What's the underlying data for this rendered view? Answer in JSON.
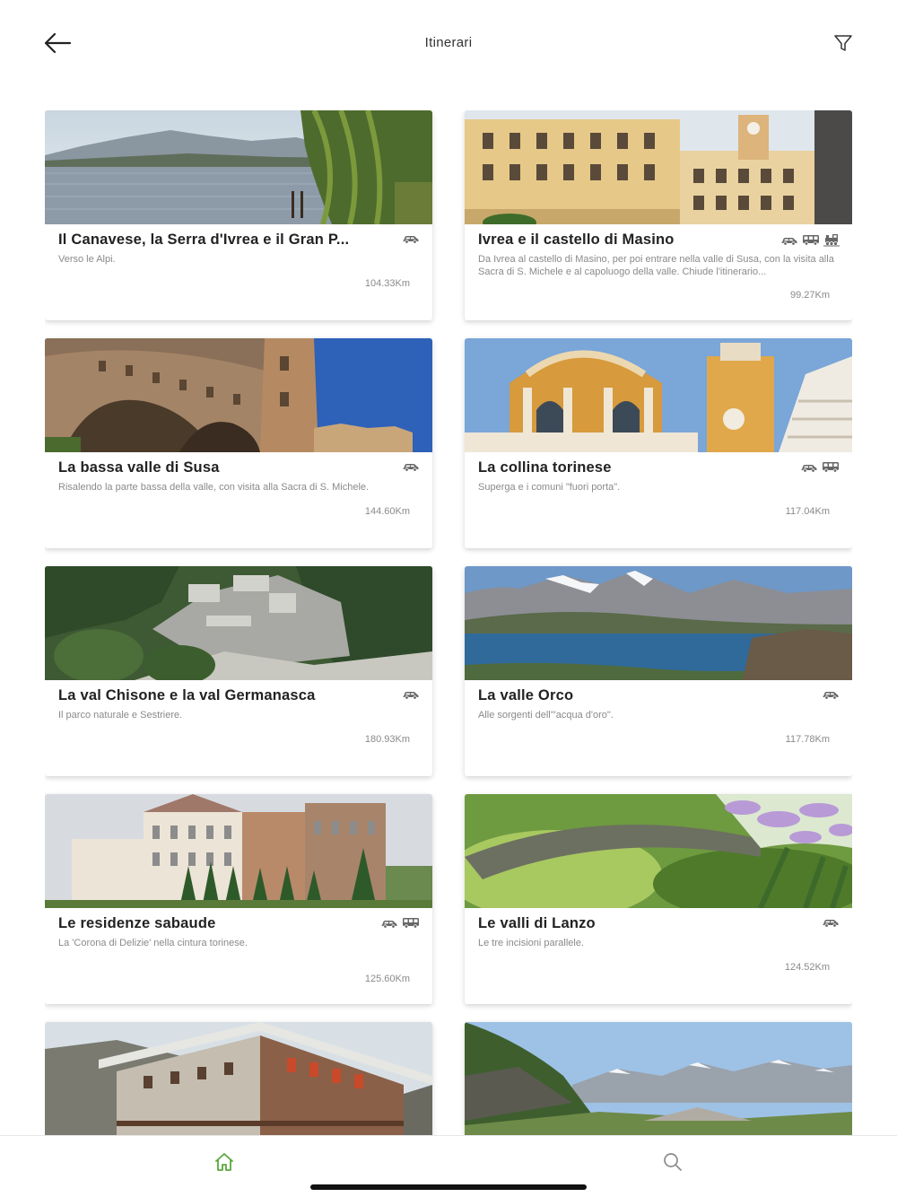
{
  "header": {
    "title": "Itinerari",
    "back_icon": "arrow-left-icon",
    "filter_icon": "filter-icon"
  },
  "cards": [
    {
      "title": "Il Canavese, la Serra d'Ivrea e il Gran P...",
      "desc": "Verso le Alpi.",
      "km": "104.33Km",
      "icons": [
        "car-icon"
      ],
      "scene": "lake"
    },
    {
      "title": "Ivrea e il castello di Masino",
      "desc": "Da Ivrea al castello di Masino, per poi entrare nella valle di Susa, con la visita alla Sacra di S. Michele e al capoluogo della valle. Chiude l'itinerario...",
      "km": "99.27Km",
      "icons": [
        "car-icon",
        "bus-icon",
        "train-icon"
      ],
      "scene": "town"
    },
    {
      "title": "La bassa valle di Susa",
      "desc": "Risalendo la parte bassa della valle, con visita alla Sacra di S. Michele.",
      "km": "144.60Km",
      "icons": [
        "car-icon"
      ],
      "scene": "castle"
    },
    {
      "title": "La collina torinese",
      "desc": "Superga e i comuni \"fuori porta\".",
      "km": "117.04Km",
      "icons": [
        "car-icon",
        "bus-icon"
      ],
      "scene": "basilica"
    },
    {
      "title": "La val Chisone e la val Germanasca",
      "desc": "Il parco naturale e Sestriere.",
      "km": "180.93Km",
      "icons": [
        "car-icon"
      ],
      "scene": "fortress"
    },
    {
      "title": "La valle Orco",
      "desc": "Alle sorgenti dell'\"acqua d'oro\".",
      "km": "117.78Km",
      "icons": [
        "car-icon"
      ],
      "scene": "mountainlake"
    },
    {
      "title": "Le residenze sabaude",
      "desc": "La 'Corona di Delizie' nella cintura torinese.",
      "km": "125.60Km",
      "icons": [
        "car-icon",
        "bus-icon"
      ],
      "scene": "palace"
    },
    {
      "title": "Le valli di Lanzo",
      "desc": "Le tre incisioni parallele.",
      "km": "124.52Km",
      "icons": [
        "car-icon"
      ],
      "scene": "bridge"
    },
    {
      "title": "",
      "desc": "",
      "km": "",
      "icons": [],
      "scene": "chalet"
    },
    {
      "title": "",
      "desc": "",
      "km": "",
      "icons": [],
      "scene": "alps"
    }
  ],
  "tabbar": {
    "home_icon": "home-icon",
    "search_icon": "search-icon",
    "active_color": "#5aa83c",
    "inactive_color": "#8a8a8a"
  }
}
